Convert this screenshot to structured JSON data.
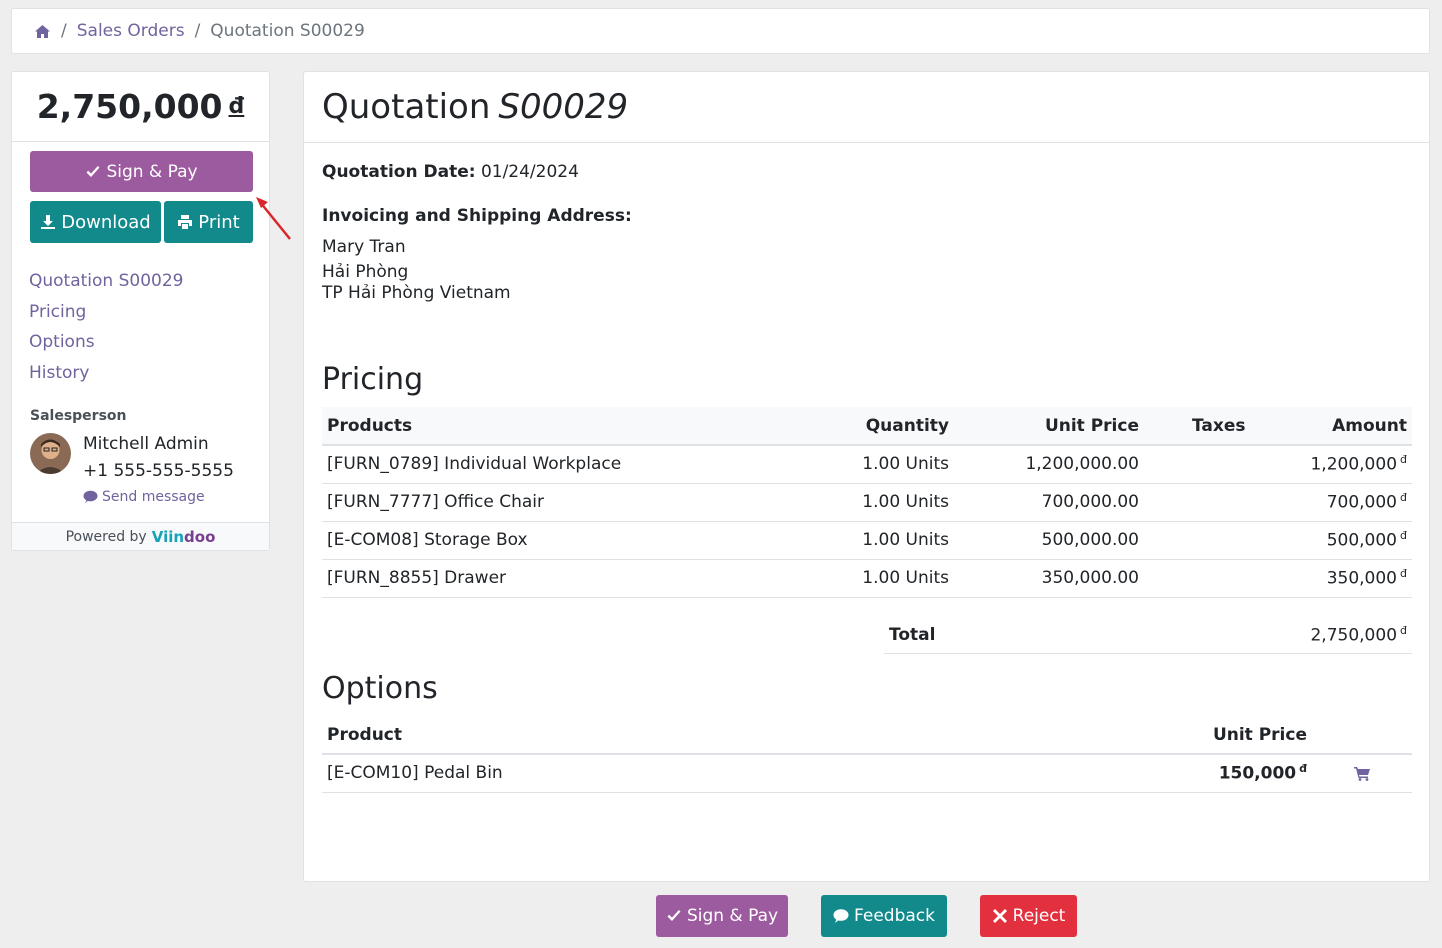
{
  "breadcrumb": {
    "home_icon": "home-icon",
    "items": [
      "Sales Orders",
      "Quotation S00029"
    ]
  },
  "sidebar": {
    "amount": "2,750,000",
    "currency": "đ",
    "sign_pay_label": "Sign & Pay",
    "download_label": "Download",
    "print_label": "Print",
    "nav": [
      "Quotation S00029",
      "Pricing",
      "Options",
      "History"
    ],
    "salesperson_label": "Salesperson",
    "salesperson_name": "Mitchell Admin",
    "salesperson_phone": "+1 555-555-5555",
    "send_message_label": "Send message",
    "powered_by": "Powered by",
    "brand_part1": "Viin",
    "brand_part2": "doo"
  },
  "main": {
    "title_prefix": "Quotation",
    "title_number": "S00029",
    "quotation_date_label": "Quotation Date:",
    "quotation_date": "01/24/2024",
    "address_label": "Invoicing and Shipping Address:",
    "address_lines": [
      "Mary Tran",
      "Hải Phòng",
      "TP Hải Phòng Vietnam"
    ],
    "pricing_heading": "Pricing",
    "pricing_columns": [
      "Products",
      "Quantity",
      "Unit Price",
      "Taxes",
      "Amount"
    ],
    "pricing_rows": [
      {
        "product": "[FURN_0789] Individual Workplace",
        "quantity": "1.00 Units",
        "unit_price": "1,200,000.00",
        "taxes": "",
        "amount": "1,200,000"
      },
      {
        "product": "[FURN_7777] Office Chair",
        "quantity": "1.00 Units",
        "unit_price": "700,000.00",
        "taxes": "",
        "amount": "700,000"
      },
      {
        "product": "[E-COM08] Storage Box",
        "quantity": "1.00 Units",
        "unit_price": "500,000.00",
        "taxes": "",
        "amount": "500,000"
      },
      {
        "product": "[FURN_8855] Drawer",
        "quantity": "1.00 Units",
        "unit_price": "350,000.00",
        "taxes": "",
        "amount": "350,000"
      }
    ],
    "currency": "đ",
    "total_label": "Total",
    "total_value": "2,750,000",
    "options_heading": "Options",
    "options_columns": [
      "Product",
      "Unit Price"
    ],
    "options_rows": [
      {
        "product": "[E-COM10] Pedal Bin",
        "unit_price": "150,000",
        "action_icon": "cart-icon"
      }
    ]
  },
  "footer_buttons": {
    "sign_pay": "Sign & Pay",
    "feedback": "Feedback",
    "reject": "Reject"
  },
  "colors": {
    "purple": "#9c5b9f",
    "teal": "#128a8c",
    "red": "#e3303f",
    "link": "#71639e"
  }
}
